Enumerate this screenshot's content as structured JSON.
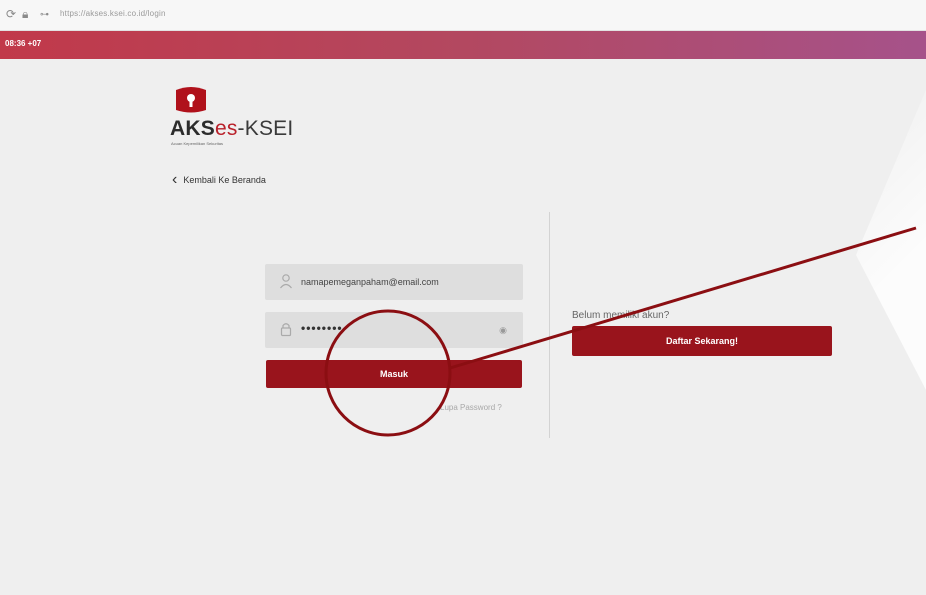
{
  "browser": {
    "url": "https://akses.ksei.co.id/login"
  },
  "topbar": {
    "time": "08:36 +07"
  },
  "logo": {
    "aks": "AKS",
    "es": "es",
    "ksei": "-KSEI",
    "subtitle": "Acuan Kepemilikan Sekuritas"
  },
  "nav": {
    "back_label": "Kembali Ke Beranda"
  },
  "login": {
    "email_value": "namapemeganpaham@email.com",
    "password_value": "••••••••",
    "submit_label": "Masuk",
    "forgot_label": "Lupa Password ?"
  },
  "register": {
    "prompt": "Belum memiliki akun?",
    "button_label": "Daftar Sekarang!"
  },
  "colors": {
    "brand_red": "#99141c",
    "annotation": "#8b0e12"
  }
}
